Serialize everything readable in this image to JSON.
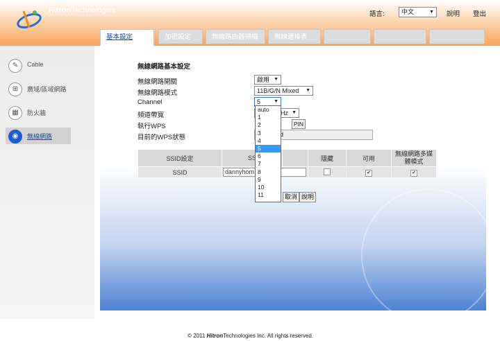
{
  "header": {
    "brand_bold": "Hitron",
    "brand_rest": "Technologies",
    "language_label": "語言:",
    "language_value": "中文",
    "help_label": "說明",
    "logout_label": "登出"
  },
  "tabs": [
    {
      "label": "基本設定",
      "active": true
    },
    {
      "label": "加密設定",
      "active": false
    },
    {
      "label": "無線路由器掃描",
      "active": false
    },
    {
      "label": "無線連接表",
      "active": false
    },
    {
      "label": "",
      "active": false
    },
    {
      "label": "",
      "active": false
    }
  ],
  "sidebar": {
    "items": [
      {
        "label": "Cable",
        "icon": "cable-icon"
      },
      {
        "label": "廣域/區域網路",
        "icon": "network-icon"
      },
      {
        "label": "防火牆",
        "icon": "firewall-icon"
      },
      {
        "label": "無線網路",
        "icon": "wireless-icon",
        "active": true
      }
    ]
  },
  "form": {
    "title": "無線網路基本設定",
    "switch_label": "無線網路開關",
    "switch_value": "啟用",
    "mode_label": "無線網路模式",
    "mode_value": "11B/G/N Mixed",
    "channel_label": "Channel",
    "channel_value": "5",
    "bandwidth_label": "頻道帶寬",
    "bandwidth_value_partial": "Hz",
    "wps_label": "執行WPS",
    "pin_label": "PIN",
    "wps_status_label": "目前的WPS狀態",
    "wps_status_value_partial": "d"
  },
  "channel_options": [
    "auto",
    "1",
    "2",
    "3",
    "4",
    "5",
    "6",
    "7",
    "8",
    "9",
    "10",
    "11"
  ],
  "channel_selected_index": 5,
  "ssid_table": {
    "headers": [
      "SSID設定",
      "SS",
      "",
      "隱藏",
      "可用",
      "無線網路多媒體模式"
    ],
    "row": {
      "label": "SSID",
      "value": "dannyhom",
      "hidden": false,
      "enabled": true,
      "wmm": true
    }
  },
  "buttons": {
    "cancel": "取消",
    "help": "說明"
  },
  "footer": {
    "copyright": "© 2011",
    "brand_bold": "Hitron",
    "brand_rest": "Technologies",
    "suffix": "Inc.  All rights reserved."
  }
}
